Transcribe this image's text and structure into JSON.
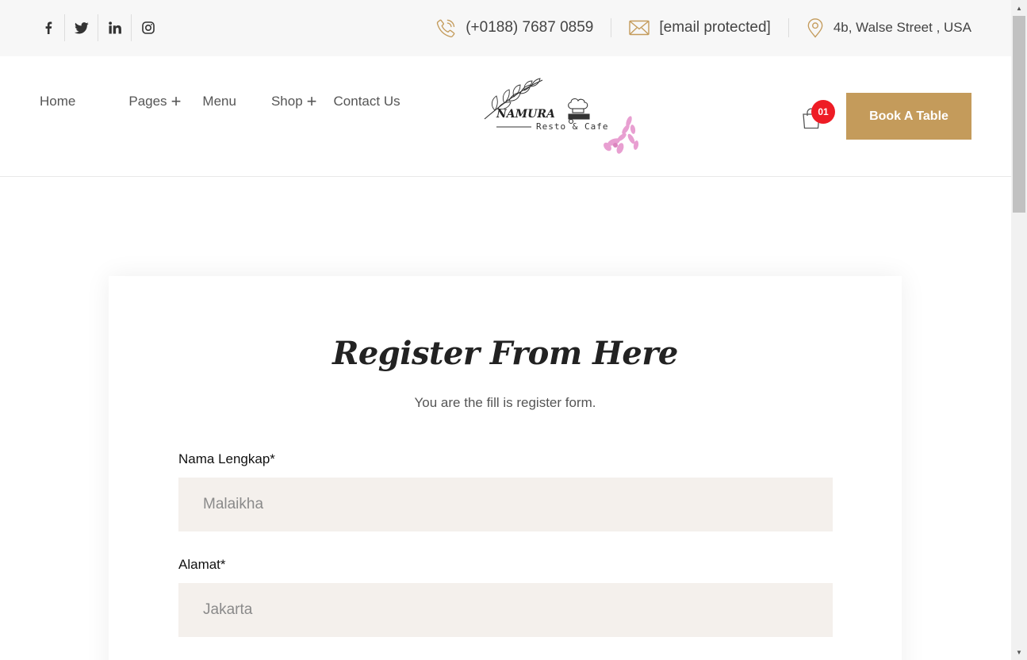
{
  "topbar": {
    "social": [
      {
        "name": "facebook-icon"
      },
      {
        "name": "twitter-icon"
      },
      {
        "name": "linkedin-icon"
      },
      {
        "name": "instagram-icon"
      }
    ],
    "phone": "(+0188) 7687 0859",
    "email": "[email protected]",
    "address": "4b, Walse Street , USA",
    "icon_color": "#c49b5b"
  },
  "nav": {
    "items": [
      {
        "label": "Home",
        "has_submenu": false
      },
      {
        "label": "Pages",
        "has_submenu": true
      },
      {
        "label": "Menu",
        "has_submenu": false
      },
      {
        "label": "Shop",
        "has_submenu": true
      },
      {
        "label": "Contact Us",
        "has_submenu": false
      }
    ],
    "submenu_symbol": "+"
  },
  "logo": {
    "name": "NAMURA",
    "tagline": "Resto & Cafe"
  },
  "cart": {
    "count": "01"
  },
  "book_button": {
    "label": "Book A Table",
    "color": "#c49b5b"
  },
  "form": {
    "title": "Register From Here",
    "subtitle": "You are the fill is register form.",
    "fields": [
      {
        "label": "Nama Lengkap*",
        "placeholder": "Malaikha"
      },
      {
        "label": "Alamat*",
        "placeholder": "Jakarta"
      }
    ]
  }
}
